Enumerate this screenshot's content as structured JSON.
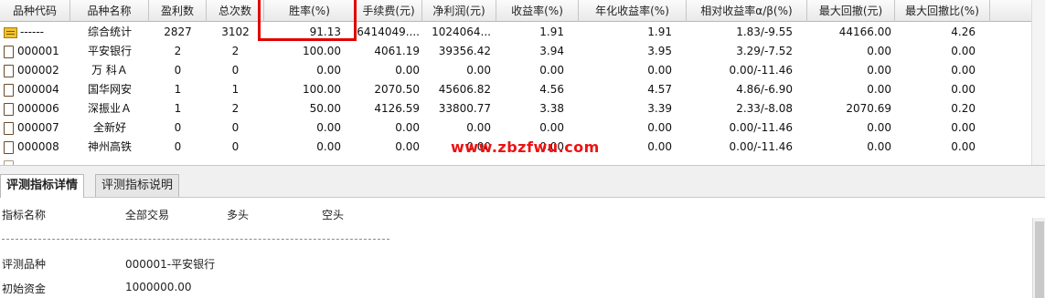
{
  "table": {
    "headers": [
      "品种代码",
      "品种名称",
      "盈利数",
      "总次数",
      "胜率(%)",
      "手续费(元)",
      "净利润(元)",
      "收益率(%)",
      "年化收益率(%)",
      "相对收益率α/β(%)",
      "最大回撤(元)",
      "最大回撤比(%)"
    ],
    "rows": [
      {
        "icon": "summary-icon",
        "code": "------",
        "name": "综合统计",
        "wins": "2827",
        "total": "3102",
        "win_rate": "91.13",
        "fee": "6414049....",
        "net_profit": "1024064...",
        "yield": "1.91",
        "annual_yield": "1.91",
        "alpha_beta": "1.83/-9.55",
        "max_dd": "44166.00",
        "max_dd_ratio": "4.26"
      },
      {
        "icon": "document-icon",
        "code": "000001",
        "name": "平安银行",
        "wins": "2",
        "total": "2",
        "win_rate": "100.00",
        "fee": "4061.19",
        "net_profit": "39356.42",
        "yield": "3.94",
        "annual_yield": "3.95",
        "alpha_beta": "3.29/-7.52",
        "max_dd": "0.00",
        "max_dd_ratio": "0.00"
      },
      {
        "icon": "document-icon",
        "code": "000002",
        "name": "万 科Ａ",
        "wins": "0",
        "total": "0",
        "win_rate": "0.00",
        "fee": "0.00",
        "net_profit": "0.00",
        "yield": "0.00",
        "annual_yield": "0.00",
        "alpha_beta": "0.00/-11.46",
        "max_dd": "0.00",
        "max_dd_ratio": "0.00"
      },
      {
        "icon": "document-icon",
        "code": "000004",
        "name": "国华网安",
        "wins": "1",
        "total": "1",
        "win_rate": "100.00",
        "fee": "2070.50",
        "net_profit": "45606.82",
        "yield": "4.56",
        "annual_yield": "4.57",
        "alpha_beta": "4.86/-6.90",
        "max_dd": "0.00",
        "max_dd_ratio": "0.00"
      },
      {
        "icon": "document-icon",
        "code": "000006",
        "name": "深振业Ａ",
        "wins": "1",
        "total": "2",
        "win_rate": "50.00",
        "fee": "4126.59",
        "net_profit": "33800.77",
        "yield": "3.38",
        "annual_yield": "3.39",
        "alpha_beta": "2.33/-8.08",
        "max_dd": "2070.69",
        "max_dd_ratio": "0.20"
      },
      {
        "icon": "document-icon",
        "code": "000007",
        "name": "全新好",
        "wins": "0",
        "total": "0",
        "win_rate": "0.00",
        "fee": "0.00",
        "net_profit": "0.00",
        "yield": "0.00",
        "annual_yield": "0.00",
        "alpha_beta": "0.00/-11.46",
        "max_dd": "0.00",
        "max_dd_ratio": "0.00"
      },
      {
        "icon": "document-icon",
        "code": "000008",
        "name": "神州高铁",
        "wins": "0",
        "total": "0",
        "win_rate": "0.00",
        "fee": "0.00",
        "net_profit": "0.00",
        "yield": "0.00",
        "annual_yield": "0.00",
        "alpha_beta": "0.00/-11.46",
        "max_dd": "0.00",
        "max_dd_ratio": "0.00"
      }
    ]
  },
  "watermark": "www.zbzfwu.com",
  "tabs": [
    "评测指标详情",
    "评测指标说明"
  ],
  "details": {
    "col_headers": [
      "指标名称",
      "全部交易",
      "多头",
      "空头"
    ],
    "rows": [
      {
        "label": "评测品种",
        "value": "000001-平安银行"
      },
      {
        "label": "初始资金",
        "value": "1000000.00"
      }
    ]
  },
  "colors": {
    "highlight_box": "#e00000",
    "watermark": "#ee1111",
    "summary_icon": "#f2c230"
  }
}
